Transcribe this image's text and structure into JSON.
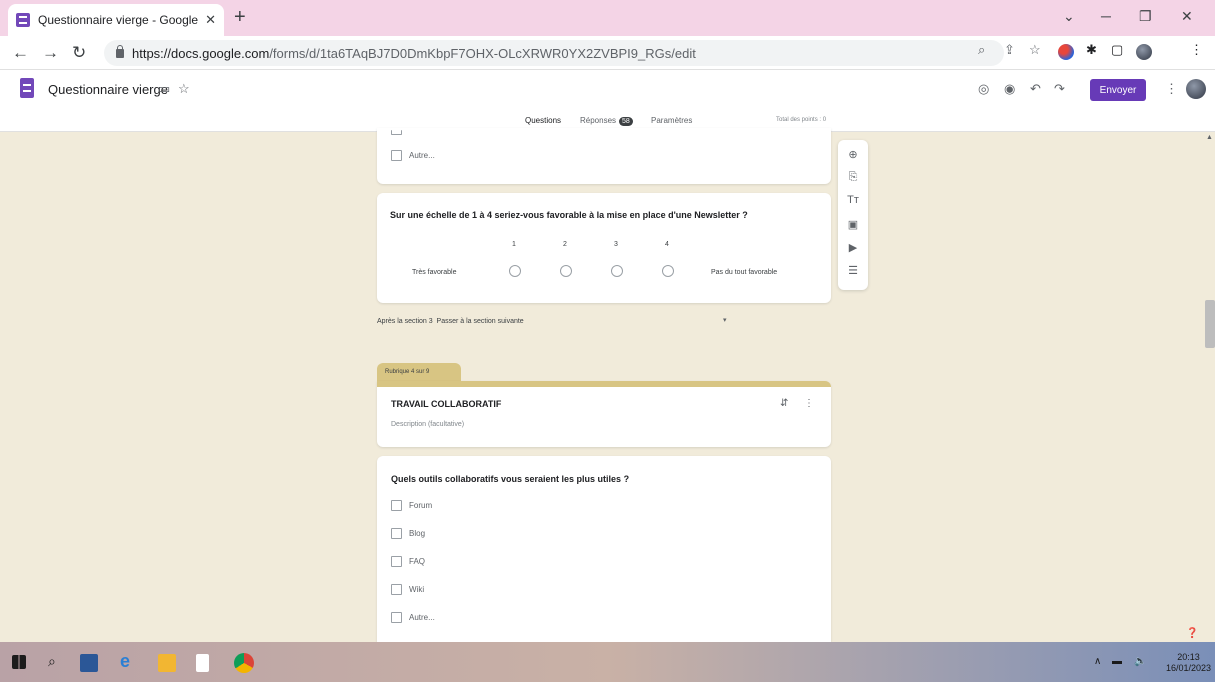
{
  "browser": {
    "tab_title": "Questionnaire vierge - Google Fo",
    "tab_close": "✕",
    "new_tab": "+",
    "url_host": "https://docs.google.com",
    "url_path": "/forms/d/1ta6TAqBJ7D0DmKbpF7OHX-OLcXRWR0YX2ZVBPI9_RGs/edit"
  },
  "header": {
    "form_title": "Questionnaire vierge",
    "send_label": "Envoyer"
  },
  "form_tabs": {
    "questions": "Questions",
    "responses": "Réponses",
    "responses_count": "58",
    "settings": "Paramètres",
    "total_points": "Total des points : 0"
  },
  "prev_question": {
    "other_option": "Autre..."
  },
  "scale_question": {
    "title": "Sur une échelle de 1 à 4 seriez-vous favorable à la mise en place d'une Newsletter ?",
    "numbers": [
      "1",
      "2",
      "3",
      "4"
    ],
    "low_label": "Très favorable",
    "high_label": "Pas du tout favorable"
  },
  "after_section": {
    "label": "Après la section 3",
    "value": "Passer à la section suivante",
    "arrow": "▾"
  },
  "section": {
    "tab_label": "Rubrique 4 sur 9",
    "title": "TRAVAIL COLLABORATIF",
    "description": "Description (facultative)"
  },
  "tools_question": {
    "title": "Quels outils collaboratifs vous seraient les plus utiles ?",
    "options": [
      "Forum",
      "Blog",
      "FAQ",
      "Wiki",
      "Autre..."
    ]
  },
  "taskbar": {
    "time": "20:13",
    "date": "16/01/2023"
  },
  "colors": {
    "accent": "#673ab7",
    "background": "#f1ebda",
    "section_tab": "#d8c583"
  }
}
